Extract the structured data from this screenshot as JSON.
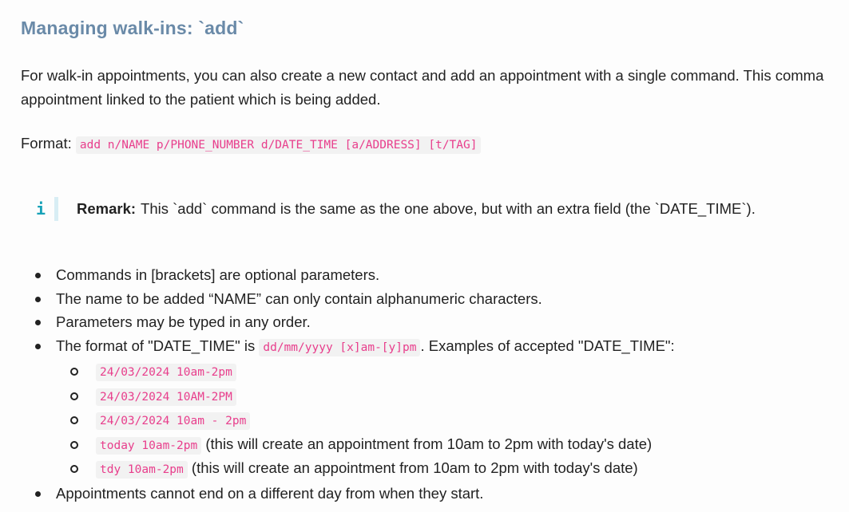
{
  "heading": "Managing walk-ins: `add`",
  "intro": {
    "line1": "For walk-in appointments, you can also create a new contact and add an appointment with a single command. This comma",
    "line2": "appointment linked to the patient which is being added."
  },
  "format": {
    "label": "Format:",
    "code": "add n/NAME p/PHONE_NUMBER d/DATE_TIME [a/ADDRESS] [t/TAG]"
  },
  "remark": {
    "icon": "info-icon",
    "label": "Remark:",
    "text": "This `add` command is the same as the one above, but with an extra field (the `DATE_TIME`)."
  },
  "bullets": {
    "b1": "Commands in [brackets] are optional parameters.",
    "b2": "The name to be added “NAME” can only contain alphanumeric characters.",
    "b3": "Parameters may be typed in any order.",
    "b4_pre": "The format of \"DATE_TIME\" is",
    "b4_code": "dd/mm/yyyy [x]am-[y]pm",
    "b4_post": ". Examples of accepted \"DATE_TIME\":",
    "b5": "Appointments cannot end on a different day from when they start."
  },
  "examples": [
    {
      "code": "24/03/2024 10am-2pm",
      "note": ""
    },
    {
      "code": "24/03/2024 10AM-2PM",
      "note": ""
    },
    {
      "code": "24/03/2024 10am - 2pm",
      "note": ""
    },
    {
      "code": "today 10am-2pm",
      "note": "(this will create an appointment from 10am to 2pm with today's date)"
    },
    {
      "code": "tdy 10am-2pm",
      "note": "(this will create an appointment from 10am to 2pm with today's date)"
    }
  ]
}
